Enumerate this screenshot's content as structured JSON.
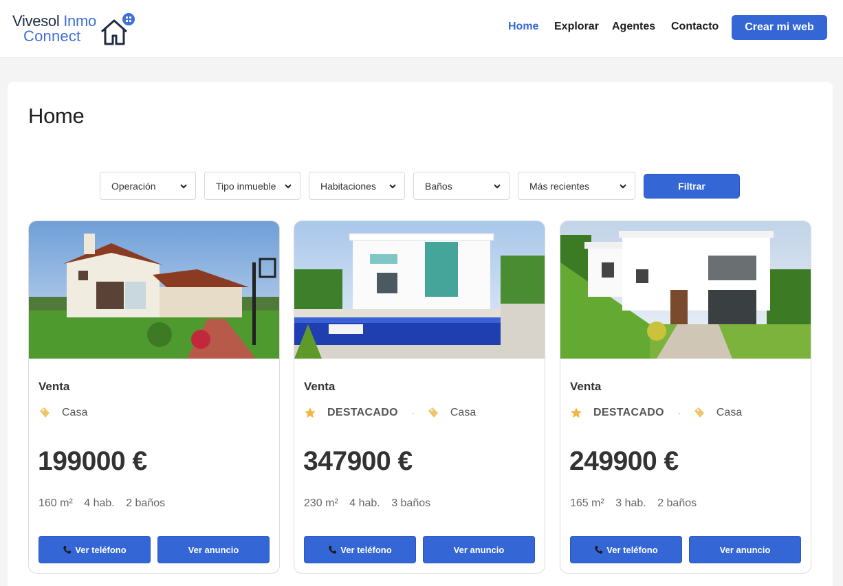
{
  "header": {
    "logo": {
      "word1": "Vivesol",
      "word2": "Inmo",
      "word3": "Connect"
    },
    "nav": [
      "Home",
      "Explorar",
      "Agentes",
      "Contacto"
    ],
    "cta": "Crear mi web"
  },
  "main": {
    "title": "Home",
    "filters": {
      "operation": "Operación",
      "property_type": "Tipo inmueble",
      "rooms": "Habitaciones",
      "baths": "Baños",
      "sort": "Más recientes",
      "button": "Filtrar"
    },
    "listings": [
      {
        "operation": "Venta",
        "featured": "",
        "type": "Casa",
        "price": "199000 €",
        "area": "160 m²",
        "rooms": "4 hab.",
        "baths": "2 baños",
        "phone_btn": "Ver teléfono",
        "view_btn": "Ver anuncio"
      },
      {
        "operation": "Venta",
        "featured": "DESTACADO",
        "type": "Casa",
        "price": "347900 €",
        "area": "230 m²",
        "rooms": "4 hab.",
        "baths": "3 baños",
        "phone_btn": "Ver teléfono",
        "view_btn": "Ver anuncio"
      },
      {
        "operation": "Venta",
        "featured": "DESTACADO",
        "type": "Casa",
        "price": "249900 €",
        "area": "165 m²",
        "rooms": "3 hab.",
        "baths": "2 baños",
        "phone_btn": "Ver teléfono",
        "view_btn": "Ver anuncio"
      }
    ]
  },
  "colors": {
    "accent": "#3466d6",
    "featured_star": "#f2b744",
    "tag": "#f0c56a"
  }
}
